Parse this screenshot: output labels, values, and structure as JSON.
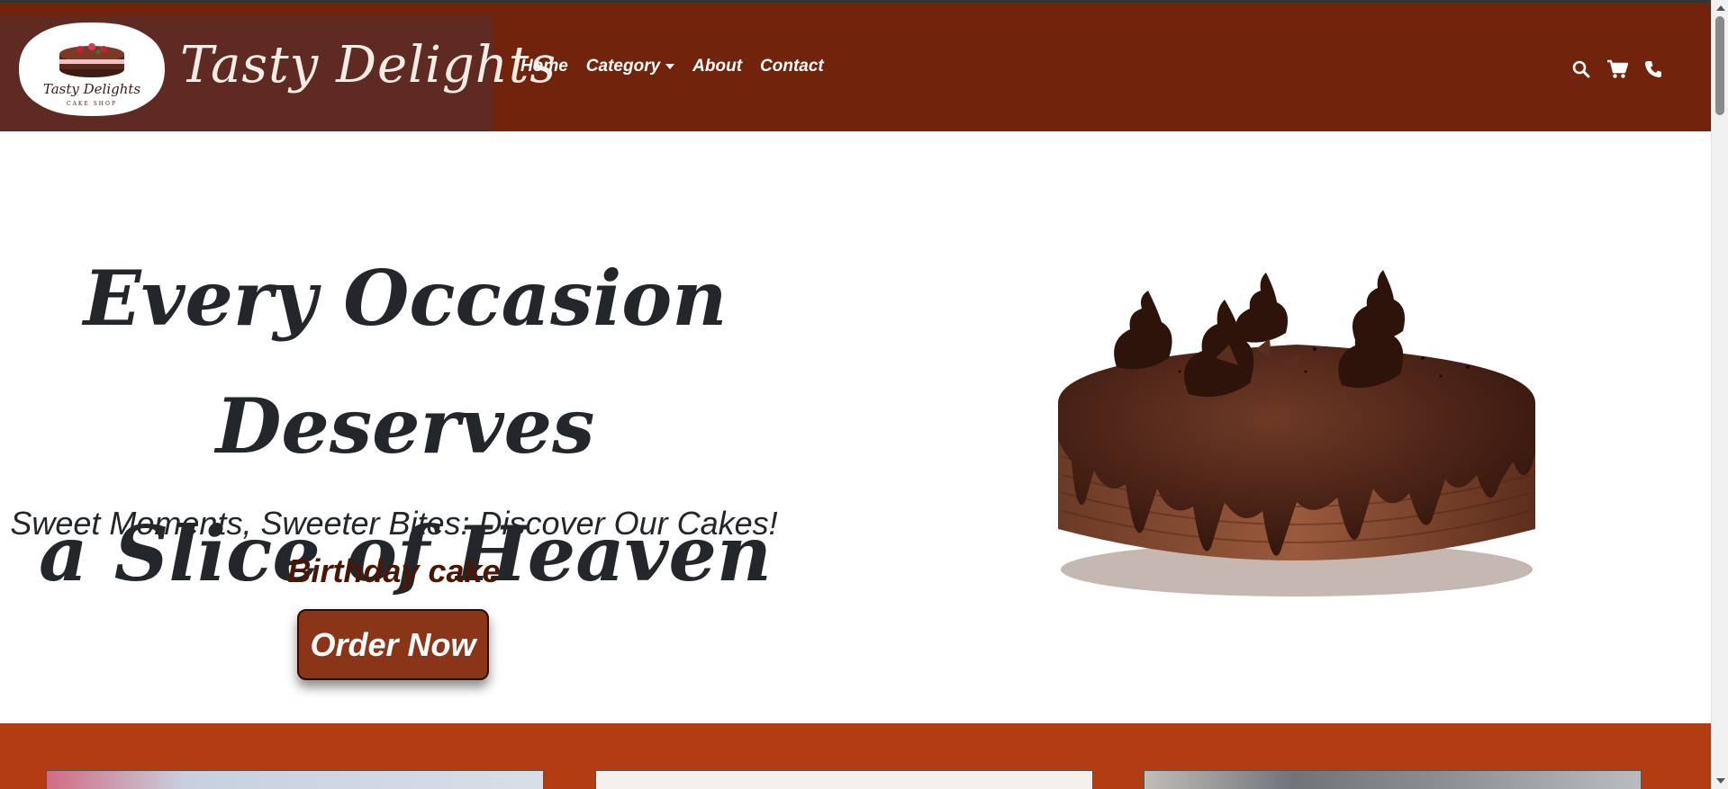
{
  "brand": {
    "name": "Tasty Delights",
    "logo_text": "Tasty Delights",
    "logo_subtext": "CAKE SHOP"
  },
  "nav": {
    "items": [
      {
        "label": "Home"
      },
      {
        "label": "Category",
        "has_dropdown": true
      },
      {
        "label": "About"
      },
      {
        "label": "Contact"
      }
    ],
    "icons": [
      "search-icon",
      "cart-icon",
      "phone-icon"
    ]
  },
  "hero": {
    "headline_line1": "Every Occasion Deserves",
    "headline_line2": "a Slice of Heaven",
    "subheadline": "Sweet Moments, Sweeter Bites: Discover Our Cakes!",
    "cake_type": "Birthday cake",
    "cta_label": "Order Now"
  },
  "colors": {
    "navbar": "#72230b",
    "brand_panel": "#5e2a22",
    "band": "#b23d13",
    "button": "#8b3518",
    "headline": "#23262b",
    "cake_type": "#4a1606"
  }
}
